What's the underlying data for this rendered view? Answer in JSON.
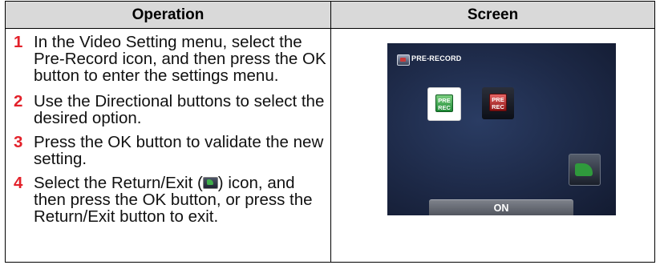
{
  "headers": {
    "operation": "Operation",
    "screen": "Screen"
  },
  "steps": [
    {
      "num": "1",
      "text": "In the Video Setting menu, select the Pre-Record icon, and then press the OK button to enter the settings menu."
    },
    {
      "num": "2",
      "text": "Use the Directional buttons to select the desired option."
    },
    {
      "num": "3",
      "text": "Press the OK button to validate the new setting."
    },
    {
      "num": "4",
      "text_before": "Select the Return/Exit (",
      "text_after": ") icon, and then press the OK button, or press the Return/Exit button to exit.",
      "inline_icon": "return-exit-icon"
    }
  ],
  "screen": {
    "title": "PRE-RECORD",
    "title_icon": "video-setting-icon",
    "options": [
      {
        "line1": "PRE",
        "line2": "REC",
        "state": "selected",
        "color": "#2f9a3c"
      },
      {
        "line1": "PRE",
        "line2": "REC",
        "state": "unselected",
        "color": "#c42626"
      }
    ],
    "return_icon": "return-exit-icon",
    "value_label": "ON"
  },
  "colors": {
    "step_number": "#e3212a",
    "header_bg": "#d9d9d9",
    "screen_bg": "#1d2947"
  }
}
